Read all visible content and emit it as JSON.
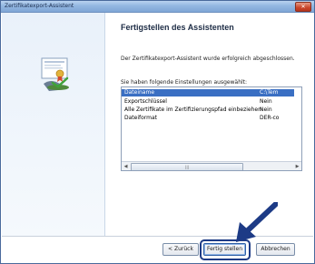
{
  "window": {
    "title": "Zertifikatexport-Assistent",
    "close_symbol": "✕"
  },
  "content": {
    "heading": "Fertigstellen des Assistenten",
    "message": "Der Zertifikatexport-Assistent wurde erfolgreich abgeschlossen.",
    "settings_label": "Sie haben folgende Einstellungen ausgewählt:",
    "settings": [
      {
        "name": "Dateiname",
        "value": "C:\\Tem"
      },
      {
        "name": "Exportschlüssel",
        "value": "Nein"
      },
      {
        "name": "Alle Zertifikate im Zertifizierungspfad einbeziehen",
        "value": "Nein"
      },
      {
        "name": "Dateiformat",
        "value": "DER-co"
      }
    ],
    "scrollbar": {
      "left_arrow": "◀",
      "right_arrow": "▶",
      "thumb_grip": "|||"
    }
  },
  "buttons": {
    "back": "< Zurück",
    "finish": "Fertig stellen",
    "cancel": "Abbrechen"
  },
  "colors": {
    "selection": "#3a6fc3",
    "annotation_arrow": "#1d3b86",
    "titlebar": "#93b7e1"
  }
}
